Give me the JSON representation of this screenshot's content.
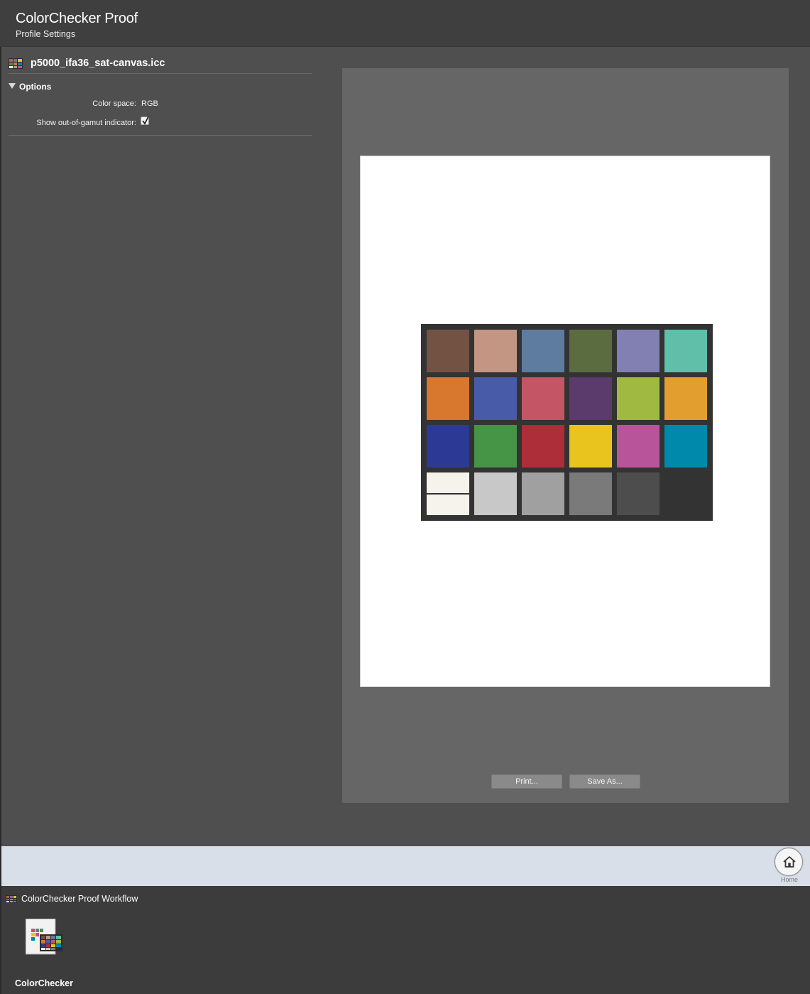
{
  "header": {
    "title": "ColorChecker Proof",
    "subtitle": "Profile Settings"
  },
  "profile": {
    "icon": "colorchecker-chart-icon",
    "name": "p5000_ifa36_sat-canvas.icc"
  },
  "options": {
    "section_label": "Options",
    "expanded": true,
    "color_space_label": "Color space:",
    "color_space_value": "RGB",
    "gamut_label": "Show out-of-gamut indicator:",
    "gamut_checked": true
  },
  "preview": {
    "chart": {
      "rows": [
        [
          "#735244",
          "#c29682",
          "#5e7ba0",
          "#5a6c40",
          "#8280b2",
          "#5fbfa9"
        ],
        [
          "#d8772e",
          "#485ba8",
          "#c35565",
          "#5b3a6c",
          "#a0ba41",
          "#e29f30"
        ],
        [
          "#2d3a95",
          "#469446",
          "#ad2d38",
          "#e9c41e",
          "#b7549a",
          "#0089aa"
        ],
        [
          "#f5f3ec",
          "#c8c8c8",
          "#a0a0a0",
          "#7a7a7a",
          "#4d4d4d",
          "#333333"
        ]
      ]
    }
  },
  "actions": {
    "print_label": "Print...",
    "save_label": "Save As..."
  },
  "nav": {
    "home_icon": "home-icon",
    "home_label": "Home"
  },
  "workflow": {
    "title": "ColorChecker Proof Workflow",
    "item_label": "ColorChecker"
  }
}
